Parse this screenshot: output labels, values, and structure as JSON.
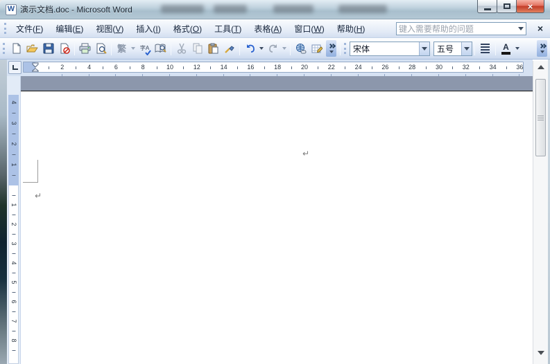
{
  "window": {
    "title": "演示文档.doc - Microsoft Word",
    "icon_letter": "W"
  },
  "glyphs": {
    "close_x": "×",
    "menubar_close": "×",
    "traditional": "繁",
    "spell": "字A",
    "font_color": "A",
    "paragraph_mark": "↵"
  },
  "menubar": {
    "items": [
      {
        "label": "文件",
        "key": "F"
      },
      {
        "label": "编辑",
        "key": "E"
      },
      {
        "label": "视图",
        "key": "V"
      },
      {
        "label": "插入",
        "key": "I"
      },
      {
        "label": "格式",
        "key": "O"
      },
      {
        "label": "工具",
        "key": "T"
      },
      {
        "label": "表格",
        "key": "A"
      },
      {
        "label": "窗口",
        "key": "W"
      },
      {
        "label": "帮助",
        "key": "H"
      }
    ]
  },
  "help_box": {
    "placeholder": "键入需要帮助的问题"
  },
  "formatting": {
    "font_name": "宋体",
    "font_size": "五号"
  },
  "ruler": {
    "h_numbers": [
      2,
      4,
      6,
      8,
      10,
      12,
      14,
      16,
      18,
      20,
      22,
      24,
      26,
      28,
      30,
      32,
      34,
      36
    ],
    "v_top_numbers": [
      4,
      3,
      2,
      1
    ],
    "v_bottom_numbers": [
      1,
      2,
      3,
      4,
      5,
      6,
      7,
      8
    ]
  },
  "colors": {
    "close_button_red": "#c23b28",
    "workspace_gray": "#8c97ac",
    "ruler_margin_blue": "#acc2e6"
  }
}
